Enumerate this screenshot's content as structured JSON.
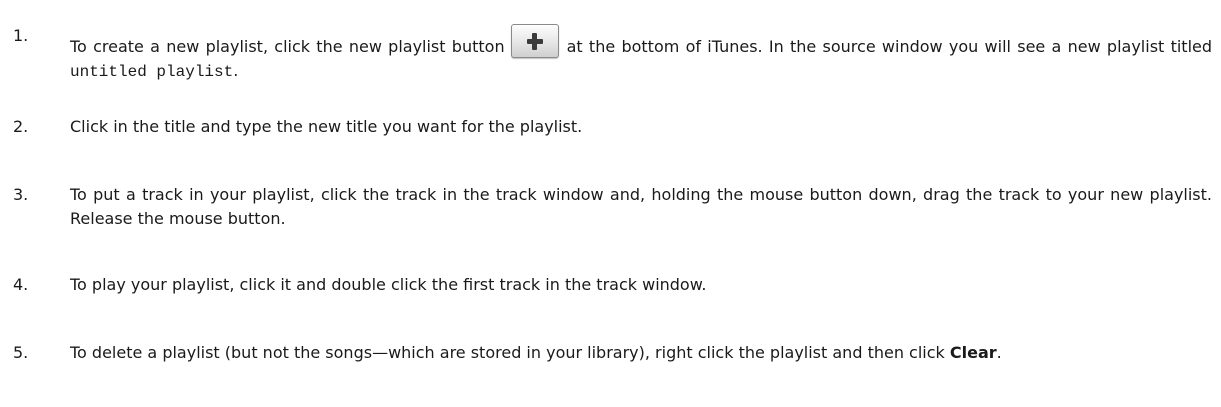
{
  "steps": [
    {
      "number": "1.",
      "text_before_button": "To create a new playlist, click the new playlist button",
      "button_icon": "plus-icon",
      "text_after_button": "at the bottom of iTunes. In the source window you will see a new playlist titled",
      "code": "untitled playlist",
      "text_end": "."
    },
    {
      "number": "2.",
      "text": "Click in the title and type the new title you want for the playlist."
    },
    {
      "number": "3.",
      "text": "To put a track in your playlist, click the track in the track window and, holding the mouse button down, drag the track to your new playlist. Release the mouse button."
    },
    {
      "number": "4.",
      "text": "To play your playlist, click it and double click the first track in the track window."
    },
    {
      "number": "5.",
      "text": "To delete a playlist (but not the songs—which are stored in your library), right click the playlist and then click",
      "bold": "Clear",
      "text_end": "."
    }
  ]
}
